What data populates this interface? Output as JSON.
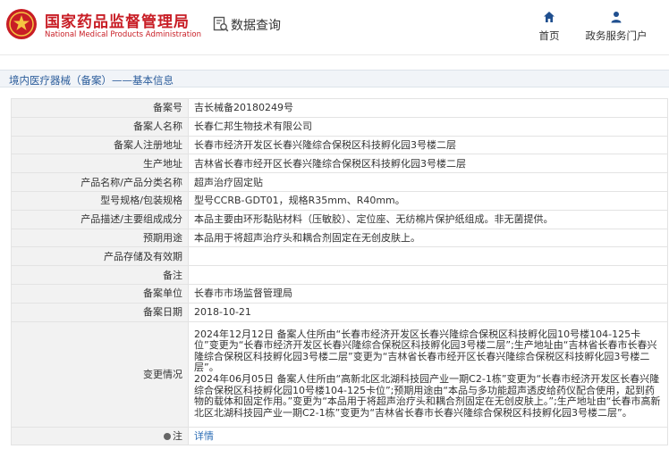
{
  "header": {
    "brand_cn": "国家药品监督管理局",
    "brand_en": "National Medical Products Administration",
    "query_label": "数据查询",
    "nav": {
      "home": "首页",
      "portal": "政务服务门户"
    },
    "brand_color": "#c81d25"
  },
  "breadcrumb": "境内医疗器械（备案）——基本信息",
  "rows": [
    {
      "label": "备案号",
      "value": "吉长械备20180249号"
    },
    {
      "label": "备案人名称",
      "value": "长春仁邦生物技术有限公司"
    },
    {
      "label": "备案人注册地址",
      "value": "长春市经济开发区长春兴隆综合保税区科技孵化园3号楼二层"
    },
    {
      "label": "生产地址",
      "value": "吉林省长春市经开区长春兴隆综合保税区科技孵化园3号楼二层"
    },
    {
      "label": "产品名称/产品分类名称",
      "value": "超声治疗固定贴"
    },
    {
      "label": "型号规格/包装规格",
      "value": "型号CCRB-GDT01，规格R35mm、R40mm。"
    },
    {
      "label": "产品描述/主要组成成分",
      "value": "本品主要由环形黏贴材料（压敏胶）、定位座、无纺棉片保护纸组成。非无菌提供。"
    },
    {
      "label": "预期用途",
      "value": "本品用于将超声治疗头和耦合剂固定在无创皮肤上。"
    },
    {
      "label": "产品存储及有效期",
      "value": ""
    },
    {
      "label": "备注",
      "value": ""
    },
    {
      "label": "备案单位",
      "value": "长春市市场监督管理局"
    },
    {
      "label": "备案日期",
      "value": "2018-10-21"
    }
  ],
  "change": {
    "label": "变更情况",
    "value": "2024年12月12日 备案人住所由“长春市经济开发区长春兴隆综合保税区科技孵化园10号楼104-125卡位”变更为“长春市经济开发区长春兴隆综合保税区科技孵化园3号楼二层”;生产地址由“吉林省长春市长春兴隆综合保税区科技孵化园3号楼二层”变更为“吉林省长春市经开区长春兴隆综合保税区科技孵化园3号楼二层”。\n2024年06月05日 备案人住所由“高新北区北湖科技园产业一期C2-1栋”变更为“长春市经济开发区长春兴隆综合保税区科技孵化园10号楼104-125卡位”;预期用途由“本品与多功能超声透皮给药仪配合使用，起到药物的载体和固定作用。”变更为“本品用于将超声治疗头和耦合剂固定在无创皮肤上。”;生产地址由“长春市高新北区北湖科技园产业一期C2-1栋”变更为“吉林省长春市长春兴隆综合保税区科技孵化园3号楼二层”。"
  },
  "note": {
    "label": "注",
    "link": "详情"
  }
}
